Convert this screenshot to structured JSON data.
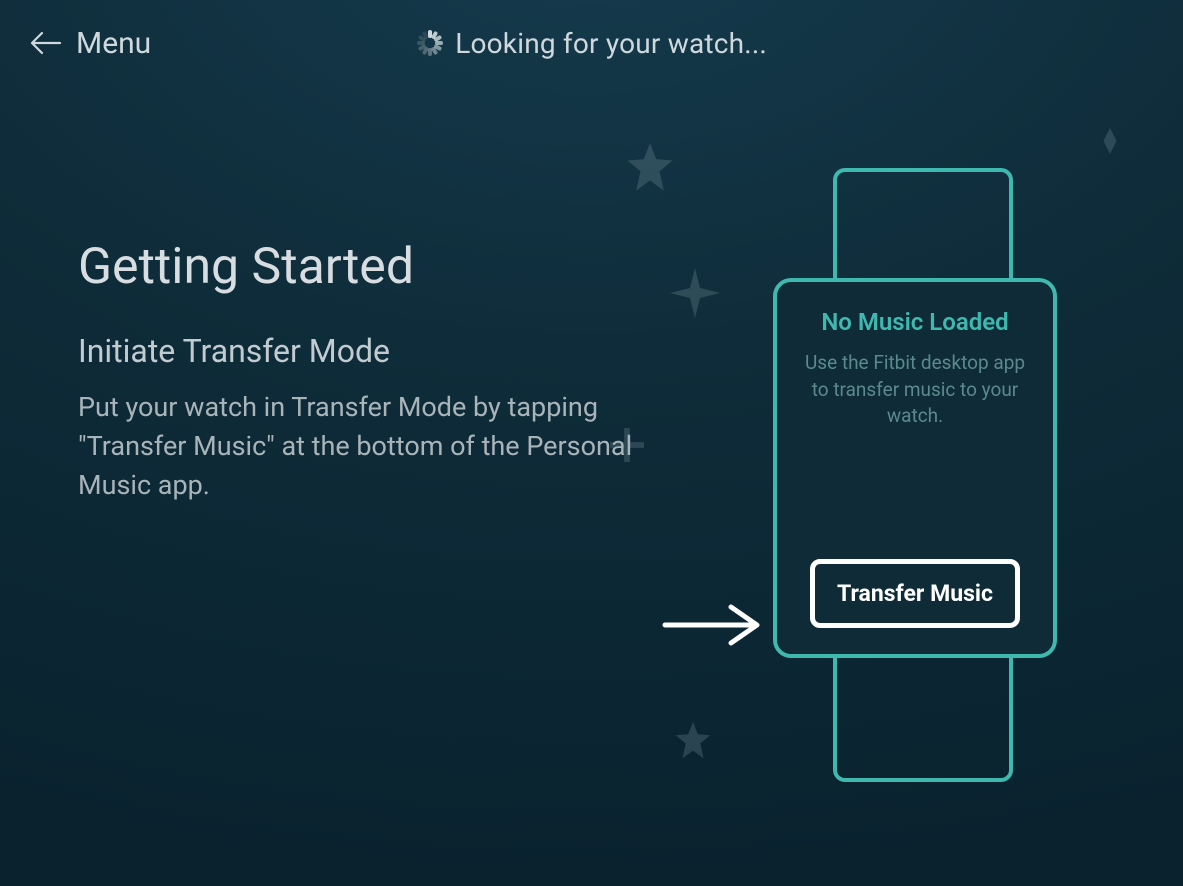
{
  "header": {
    "menu_label": "Menu",
    "status_text": "Looking for your watch..."
  },
  "main": {
    "title": "Getting Started",
    "subtitle": "Initiate Transfer Mode",
    "body": "Put your watch in Transfer Mode by tapping \"Transfer Music\" at the bottom of the Personal Music app."
  },
  "watch": {
    "title": "No Music Loaded",
    "body": "Use the Fitbit desktop app to transfer music to your watch.",
    "button_label": "Transfer Music"
  }
}
